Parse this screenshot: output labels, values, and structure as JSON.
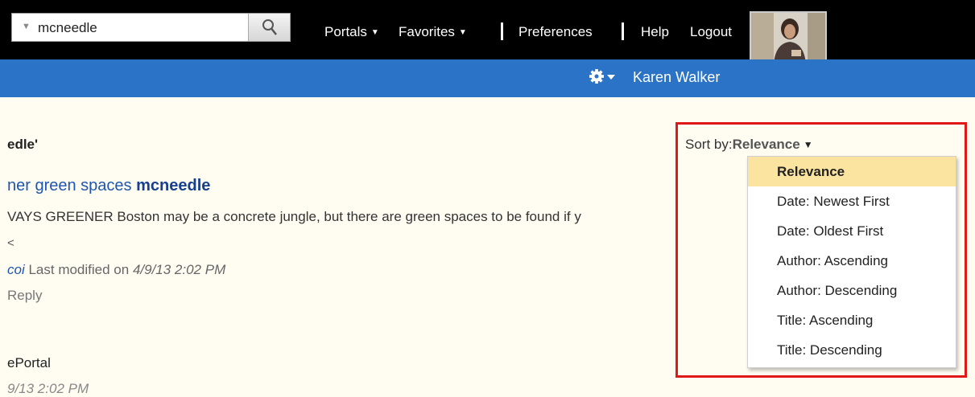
{
  "search": {
    "value": "mcneedle",
    "caret": "▼"
  },
  "nav": {
    "portals": "Portals",
    "favorites": "Favorites",
    "preferences": "Preferences",
    "help": "Help",
    "logout": "Logout",
    "caret": "▼"
  },
  "user": {
    "name": "Karen Walker"
  },
  "results": {
    "heading": "edle'",
    "title_plain": "ner green spaces ",
    "title_bold": "mcneedle",
    "snippet": "VAYS GREENER   Boston may be a concrete jungle, but there are green spaces to be found if y",
    "snippet_continuation": "<",
    "author": "coi",
    "modified_label": " Last modified on ",
    "modified_date": "4/9/13 2:02 PM",
    "reply": "Reply",
    "second_source": "ePortal",
    "second_date": "9/13 2:02 PM"
  },
  "sort": {
    "label": "Sort by:",
    "current": "Relevance",
    "caret": "▼",
    "options": [
      "Relevance",
      "Date: Newest First",
      "Date: Oldest First",
      "Author: Ascending",
      "Author: Descending",
      "Title: Ascending",
      "Title: Descending"
    ]
  },
  "colors": {
    "topbar": "#000000",
    "bluebar": "#2a73c7",
    "page_bg": "#fffdf2",
    "highlight_frame": "#e01818",
    "selected_option": "#fbe3a0"
  }
}
